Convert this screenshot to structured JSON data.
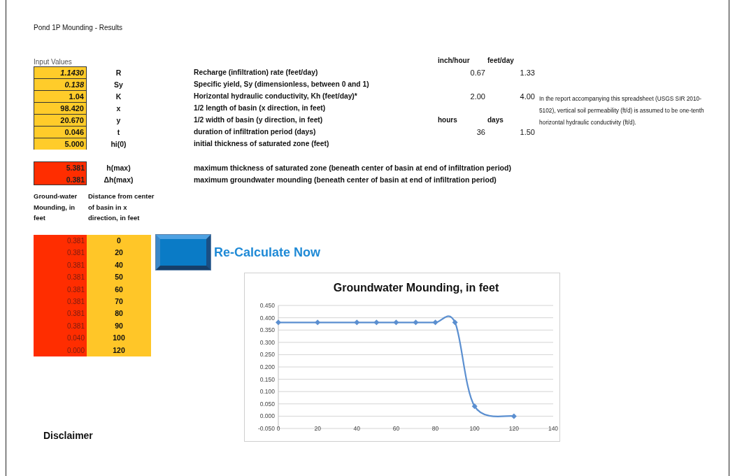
{
  "title": "Pond 1P Mounding - Results",
  "input_header": "Input Values",
  "inputs": [
    {
      "value": "1.1430",
      "italic": true,
      "symbol": "R",
      "description": "Recharge (infiltration) rate (feet/day)"
    },
    {
      "value": "0.138",
      "italic": true,
      "symbol": "Sy",
      "description": "Specific yield, Sy (dimensionless, between 0 and 1)"
    },
    {
      "value": "1.04",
      "italic": false,
      "symbol": "K",
      "description": "Horizontal hydraulic conductivity, Kh  (feet/day)*"
    },
    {
      "value": "98.420",
      "italic": false,
      "symbol": "x",
      "description": "1/2 length of basin (x direction, in feet)"
    },
    {
      "value": "20.670",
      "italic": false,
      "symbol": "y",
      "description": "1/2 width of basin (y direction, in feet)"
    },
    {
      "value": "0.046",
      "italic": false,
      "symbol": "t",
      "description": "duration of infiltration period (days)"
    },
    {
      "value": "5.000",
      "italic": false,
      "symbol": "hi(0)",
      "description": "initial thickness of saturated zone (feet)"
    }
  ],
  "conversions": {
    "rate_headers": [
      "inch/hour",
      "feet/day"
    ],
    "recharge": [
      "0.67",
      "1.33"
    ],
    "conductivity": [
      "2.00",
      "4.00"
    ],
    "time_headers": [
      "hours",
      "days"
    ],
    "duration": [
      "36",
      "1.50"
    ]
  },
  "note": "In the report accompanying this spreadsheet (USGS SIR 2010-5102), vertical soil permeability (ft/d) is assumed to be one-tenth horizontal hydraulic conductivity (ft/d).",
  "results": [
    {
      "value": "5.381",
      "symbol": "h(max)",
      "description": "maximum thickness of saturated zone (beneath center of basin at end of infiltration period)"
    },
    {
      "value": "0.381",
      "symbol": "Δh(max)",
      "description": "maximum groundwater mounding (beneath center of basin at end of infiltration period)"
    }
  ],
  "table": {
    "columns": [
      "Ground-water Mounding, in feet",
      "Distance from center of basin in x direction, in feet"
    ],
    "rows": [
      [
        "0.381",
        "0"
      ],
      [
        "0.381",
        "20"
      ],
      [
        "0.381",
        "40"
      ],
      [
        "0.381",
        "50"
      ],
      [
        "0.381",
        "60"
      ],
      [
        "0.381",
        "70"
      ],
      [
        "0.381",
        "80"
      ],
      [
        "0.381",
        "90"
      ],
      [
        "0.040",
        "100"
      ],
      [
        "0.000",
        "120"
      ]
    ]
  },
  "recalculate_label": "Re-Calculate Now",
  "chart": {
    "chart_data": {
      "type": "line",
      "title": "Groundwater Mounding, in feet",
      "x": [
        0,
        20,
        40,
        50,
        60,
        70,
        80,
        90,
        100,
        120
      ],
      "grid": true,
      "series": [
        {
          "color": "#5b8fd0",
          "marker": "diamond",
          "values": [
            0.381,
            0.381,
            0.381,
            0.381,
            0.381,
            0.381,
            0.381,
            0.381,
            0.04,
            0.0
          ]
        }
      ],
      "xlim": [
        0,
        140
      ],
      "ylim": [
        -0.05,
        0.45
      ],
      "xticks": [
        0,
        20,
        40,
        60,
        80,
        100,
        120,
        140
      ],
      "yticks": [
        {
          "value": -0.05,
          "label": "-0.050"
        },
        {
          "value": 0,
          "label": "0.000"
        },
        {
          "value": 0.05,
          "label": "0.050"
        },
        {
          "value": 0.1,
          "label": "0.100"
        },
        {
          "value": 0.15,
          "label": "0.150"
        },
        {
          "value": 0.2,
          "label": "0.200"
        },
        {
          "value": 0.25,
          "label": "0.250"
        },
        {
          "value": 0.3,
          "label": "0.300"
        },
        {
          "value": 0.35,
          "label": "0.350"
        },
        {
          "value": 0.4,
          "label": "0.400"
        },
        {
          "value": 0.45,
          "label": "0.450"
        }
      ]
    }
  },
  "disclaimer": "Disclaimer"
}
